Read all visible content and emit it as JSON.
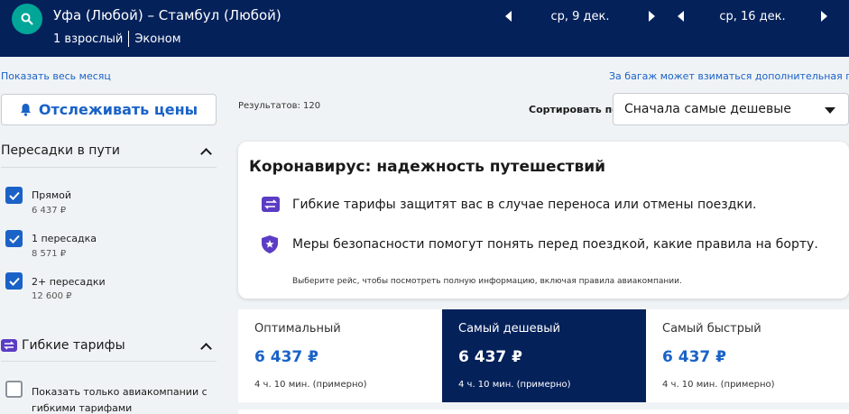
{
  "header": {
    "route": "Уфа (Любой) – Стамбул (Любой)",
    "passengers": "1 взрослый",
    "cabin_class": "Эконом",
    "depart_date": "ср, 9 дек.",
    "return_date": "ср, 16 дек."
  },
  "links": {
    "show_month": "Показать весь месяц",
    "baggage_note": "За багаж может взиматься дополнительная плата"
  },
  "track_button": "Отслеживать цены",
  "results_count": "Результатов: 120",
  "sort": {
    "label": "Сортировать по",
    "selected": "Сначала самые дешевые"
  },
  "filters": {
    "stops": {
      "title": "Пересадки в пути",
      "options": [
        {
          "label": "Прямой",
          "price": "6 437 ₽",
          "checked": true
        },
        {
          "label": "1 пересадка",
          "price": "8 571 ₽",
          "checked": true
        },
        {
          "label": "2+ пересадки",
          "price": "12 600 ₽",
          "checked": true
        }
      ]
    },
    "flexible": {
      "title": "Гибкие тарифы",
      "option": {
        "label_line1": "Показать только авиакомпании с",
        "label_line2": "гибкими тарифами",
        "checked": false
      }
    }
  },
  "covid_card": {
    "title": "Коронавирус: надежность путешествий",
    "line1": "Гибкие тарифы защитят вас в случае переноса или отмены поездки.",
    "line2": "Меры безопасности помогут понять перед поездкой, какие правила на борту.",
    "note": "Выберите рейс, чтобы посмотреть полную информацию, включая правила авиакомпании."
  },
  "tabs": [
    {
      "name": "Оптимальный",
      "price": "6 437 ₽",
      "time": "4 ч. 10 мин. (примерно)",
      "active": false
    },
    {
      "name": "Самый дешевый",
      "price": "6 437 ₽",
      "time": "4 ч. 10 мин. (примерно)",
      "active": true
    },
    {
      "name": "Самый быстрый",
      "price": "6 437 ₽",
      "time": "4 ч. 10 мин. (примерно)",
      "active": false
    }
  ],
  "colors": {
    "header_bg": "#04215a",
    "accent": "#1a62c7",
    "search_button": "#00a698",
    "icon_purple": "#5b3cc4"
  },
  "icons": {
    "search": "search-icon",
    "bell": "bell-icon",
    "flex_fare": "flexible-fare-icon",
    "shield": "shield-icon"
  }
}
